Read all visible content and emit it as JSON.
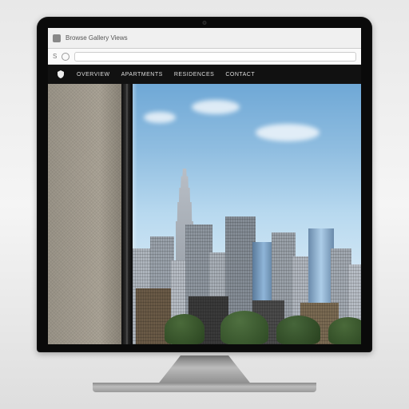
{
  "browser": {
    "tab_title": "Browse Gallery Views",
    "url_prefix": "S",
    "address": ""
  },
  "site": {
    "logo_name": "shield-icon",
    "nav": [
      {
        "label": "Overview"
      },
      {
        "label": "Apartments"
      },
      {
        "label": "Residences"
      },
      {
        "label": "Contact"
      }
    ]
  },
  "hero": {
    "description": "City skyline view through window"
  }
}
